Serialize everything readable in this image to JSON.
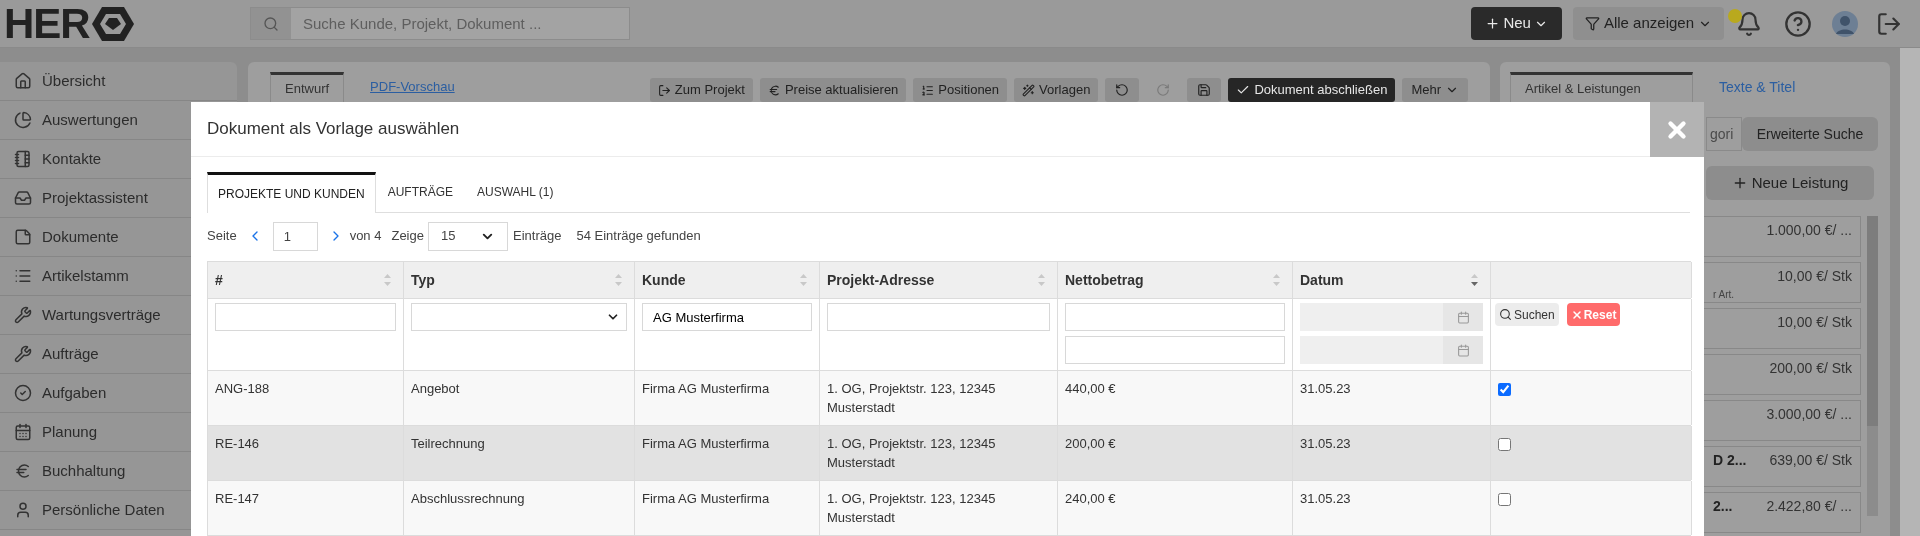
{
  "header": {
    "logo": "HER",
    "search": {
      "placeholder": "Suche Kunde, Projekt, Dokument ..."
    },
    "new_button": "Neu",
    "filter_button": "Alle anzeigen",
    "has_notification": true
  },
  "sidebar": {
    "items": [
      {
        "label": "Übersicht"
      },
      {
        "label": "Auswertungen"
      },
      {
        "label": "Kontakte"
      },
      {
        "label": "Projektassistent"
      },
      {
        "label": "Dokumente"
      },
      {
        "label": "Artikelstamm"
      },
      {
        "label": "Wartungsverträge"
      },
      {
        "label": "Aufträge"
      },
      {
        "label": "Aufgaben"
      },
      {
        "label": "Planung"
      },
      {
        "label": "Buchhaltung"
      },
      {
        "label": "Persönliche Daten"
      }
    ]
  },
  "document_editor": {
    "tabs": [
      {
        "label": "Entwurf",
        "selected": true
      },
      {
        "label": "PDF-Vorschau",
        "selected": false
      }
    ],
    "toolbar": [
      {
        "kind": "text",
        "label": "Zum Projekt",
        "disabled": false
      },
      {
        "kind": "text",
        "label": "Preise aktualisieren",
        "disabled": false
      },
      {
        "kind": "text",
        "label": "Positionen",
        "disabled": false
      },
      {
        "kind": "text",
        "label": "Vorlagen",
        "disabled": false
      },
      {
        "kind": "icon",
        "disabled": false
      },
      {
        "kind": "icon",
        "disabled": true
      },
      {
        "kind": "icon",
        "disabled": false
      },
      {
        "kind": "primary",
        "label": "Dokument abschließen",
        "disabled": false
      },
      {
        "kind": "menu",
        "label": "Mehr",
        "disabled": false
      }
    ]
  },
  "right_panel": {
    "tabs": [
      {
        "label": "Artikel & Leistungen",
        "selected": true
      },
      {
        "label": "Texte & Titel",
        "selected": false
      }
    ],
    "filter_buttons": [
      "gori",
      "Erweiterte Suche"
    ],
    "new_button": "Neue Leistung",
    "items": [
      {
        "price": "1.000,00 €/ ..."
      },
      {
        "price": "10,00 €/ Stk",
        "note": "r Art."
      },
      {
        "price": "10,00 €/ Stk"
      },
      {
        "price": "200,00 €/ Stk"
      },
      {
        "price": "3.000,00 €/ ..."
      },
      {
        "name": "D 2...",
        "price": "639,00 €/ Stk"
      },
      {
        "name": "2...",
        "price": "2.422,80 €/ ..."
      }
    ]
  },
  "modal": {
    "title": "Dokument als Vorlage auswählen",
    "tabs": [
      {
        "label": "PROJEKTE UND KUNDEN",
        "selected": true
      },
      {
        "label": "AUFTRÄGE",
        "selected": false
      },
      {
        "label": "AUSWAHL (1)",
        "selected": false
      }
    ],
    "pagination": {
      "page_label": "Seite",
      "page": "1",
      "of": "von 4",
      "show_label": "Zeige",
      "page_size": "15",
      "entries_label": "Einträge",
      "found": "54 Einträge gefunden"
    },
    "table": {
      "columns": [
        {
          "label": "#",
          "sorted": false
        },
        {
          "label": "Typ",
          "sorted": false
        },
        {
          "label": "Kunde",
          "sorted": false
        },
        {
          "label": "Projekt-Adresse",
          "sorted": false
        },
        {
          "label": "Nettobetrag",
          "sorted": false
        },
        {
          "label": "Datum",
          "sorted": true
        }
      ],
      "filters": {
        "customer": "AG Musterfirma",
        "search_button": "Suchen",
        "reset_button": "Reset"
      },
      "rows": [
        {
          "number": "ANG-188",
          "type": "Angebot",
          "customer": "Firma AG Musterfirma",
          "address": "1. OG, Projektstr. 123, 12345 Musterstadt",
          "net": "440,00 €",
          "date": "31.05.23",
          "checked": true,
          "hovered": false
        },
        {
          "number": "RE-146",
          "type": "Teilrechnung",
          "customer": "Firma AG Musterfirma",
          "address": "1. OG, Projektstr. 123, 12345 Musterstadt",
          "net": "200,00 €",
          "date": "31.05.23",
          "checked": false,
          "hovered": true
        },
        {
          "number": "RE-147",
          "type": "Abschlussrechnung",
          "customer": "Firma AG Musterfirma",
          "address": "1. OG, Projektstr. 123, 12345 Musterstadt",
          "net": "240,00 €",
          "date": "31.05.23",
          "checked": false,
          "hovered": false
        }
      ]
    }
  }
}
